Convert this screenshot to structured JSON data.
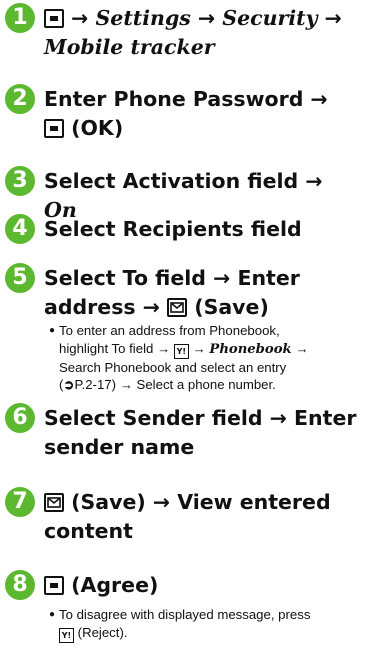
{
  "steps": [
    {
      "num": "1",
      "a": "Settings",
      "b": "Security",
      "c": "Mobile tracker"
    },
    {
      "num": "2",
      "line1": "Enter Phone Password",
      "ok": "(OK)"
    },
    {
      "num": "3",
      "text": "Select Activation field",
      "value": "On"
    },
    {
      "num": "4",
      "text": "Select Recipients field"
    },
    {
      "num": "5",
      "line1": "Select To field",
      "line1b": "Enter",
      "line2": "address",
      "save": "(Save)",
      "note": {
        "t1": "To enter an address from Phonebook,",
        "t2": "highlight To field",
        "t3": "Phonebook",
        "t4": "Search Phonebook and select an entry",
        "t5": "P.2-17)",
        "t6": "Select a phone number.",
        "t5pre": "("
      }
    },
    {
      "num": "6",
      "line1": "Select Sender field",
      "line1b": "Enter",
      "line2": "sender name"
    },
    {
      "num": "7",
      "save": "(Save)",
      "line1b": "View entered",
      "line2": "content"
    },
    {
      "num": "8",
      "agree": "(Agree)",
      "note": {
        "t1": "To disagree with displayed message, press",
        "t2": "(Reject)."
      }
    }
  ],
  "arrow": "→",
  "icons": [
    "center-key-icon",
    "mail-key-icon",
    "softkey-icon",
    "page-ref-icon"
  ],
  "accent": "#5cb82e"
}
